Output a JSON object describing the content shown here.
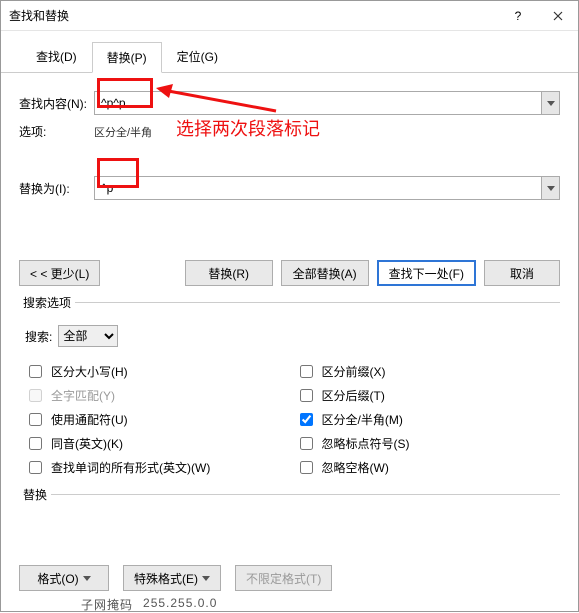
{
  "title": "查找和替换",
  "tabs": {
    "find": "查找(D)",
    "replace": "替换(P)",
    "goto": "定位(G)"
  },
  "labels": {
    "find_what": "查找内容(N):",
    "options": "选项:",
    "options_value": "区分全/半角",
    "replace_with": "替换为(I):"
  },
  "values": {
    "find": "^p^p",
    "replace": "^p"
  },
  "buttons": {
    "less": "< < 更少(L)",
    "replace": "替换(R)",
    "replace_all": "全部替换(A)",
    "find_next": "查找下一处(F)",
    "cancel": "取消"
  },
  "search_options": {
    "legend": "搜索选项",
    "search_label": "搜索:",
    "search_scope": "全部",
    "left": {
      "match_case": "区分大小写(H)",
      "whole_word": "全字匹配(Y)",
      "wildcards": "使用通配符(U)",
      "sounds_like": "同音(英文)(K)",
      "word_forms": "查找单词的所有形式(英文)(W)"
    },
    "right": {
      "match_prefix": "区分前缀(X)",
      "match_suffix": "区分后缀(T)",
      "full_half": "区分全/半角(M)",
      "ignore_punct": "忽略标点符号(S)",
      "ignore_space": "忽略空格(W)"
    }
  },
  "replace_section": {
    "legend": "替换",
    "format": "格式(O)",
    "special": "特殊格式(E)",
    "no_format": "不限定格式(T)"
  },
  "annotation": "选择两次段落标记",
  "footer": {
    "a": "子网掩码",
    "b": "255.255.0.0"
  }
}
